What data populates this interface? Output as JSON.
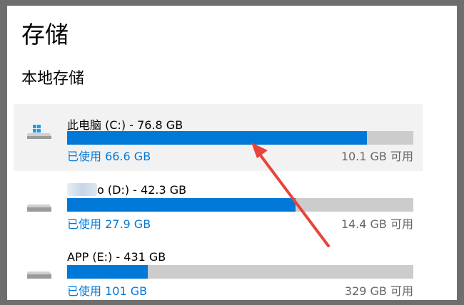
{
  "page": {
    "title": "存储",
    "section_title": "本地存储"
  },
  "drives": [
    {
      "name": "此电脑 (C:) - 76.8 GB",
      "used_label": "已使用 66.6 GB",
      "free_label": "10.1 GB 可用",
      "used_fraction": 0.867,
      "selected": true,
      "icon": "windows-drive-icon"
    },
    {
      "name_suffix": "o (D:) - 42.3 GB",
      "used_label": "已使用 27.9 GB",
      "free_label": "14.4 GB 可用",
      "used_fraction": 0.66,
      "icon": "drive-icon"
    },
    {
      "name": "APP (E:) - 431 GB",
      "used_label": "已使用 101 GB",
      "free_label": "329 GB 可用",
      "used_fraction": 0.234,
      "icon": "drive-icon"
    }
  ],
  "annotation": {
    "arrow_color": "#e8443a"
  },
  "colors": {
    "accent": "#0078d7",
    "track": "#cccccc"
  }
}
